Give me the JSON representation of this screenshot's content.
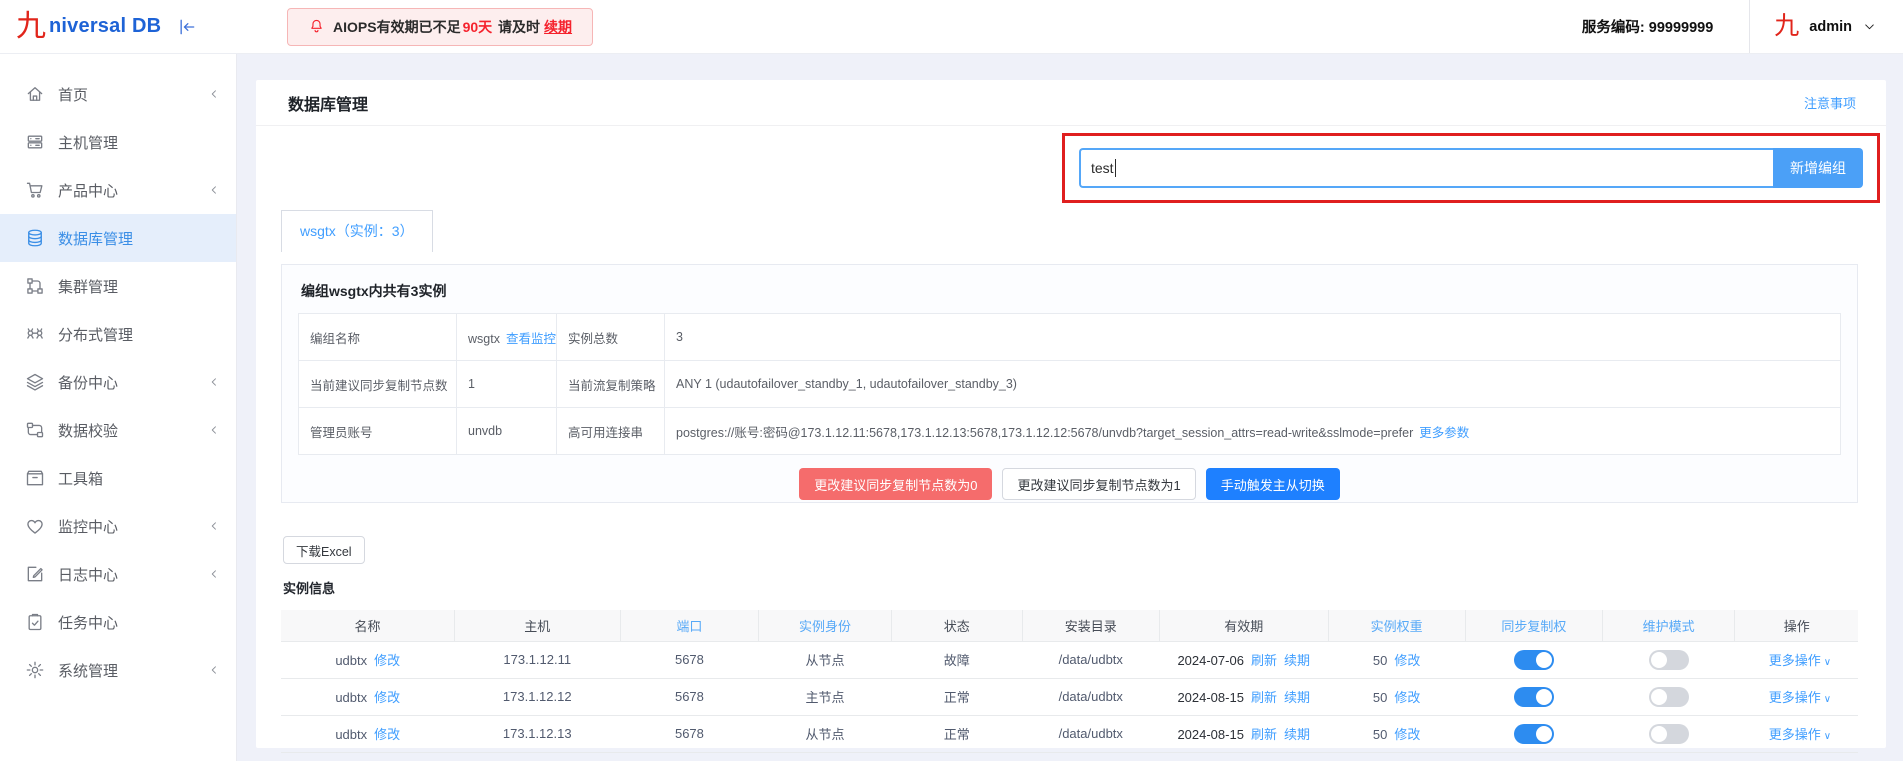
{
  "header": {
    "logo_glyph": "九",
    "logo_text": "niversal DB",
    "alert": {
      "prefix": "AIOPS有效期已不足",
      "days": "90天",
      "middle": "请及时",
      "renew_link": "续期"
    },
    "service_code_label": "服务编码:",
    "service_code_value": "99999999",
    "user_glyph": "九",
    "user_name": "admin"
  },
  "sidebar": {
    "items": [
      {
        "key": "home",
        "icon": "home-icon",
        "label": "首页",
        "active": false,
        "arrow": true
      },
      {
        "key": "host-management",
        "icon": "server-icon",
        "label": "主机管理",
        "active": false,
        "arrow": false
      },
      {
        "key": "product-center",
        "icon": "cart-icon",
        "label": "产品中心",
        "active": false,
        "arrow": true
      },
      {
        "key": "database-management",
        "icon": "database-icon",
        "label": "数据库管理",
        "active": true,
        "arrow": false
      },
      {
        "key": "cluster-management",
        "icon": "cluster-icon",
        "label": "集群管理",
        "active": false,
        "arrow": false
      },
      {
        "key": "distributed-management",
        "icon": "distributed-icon",
        "label": "分布式管理",
        "active": false,
        "arrow": false
      },
      {
        "key": "backup-center",
        "icon": "layers-icon",
        "label": "备份中心",
        "active": false,
        "arrow": true
      },
      {
        "key": "data-verification",
        "icon": "workflow-icon",
        "label": "数据校验",
        "active": false,
        "arrow": true
      },
      {
        "key": "toolbox",
        "icon": "toolbox-icon",
        "label": "工具箱",
        "active": false,
        "arrow": false
      },
      {
        "key": "monitor-center",
        "icon": "heart-icon",
        "label": "监控中心",
        "active": false,
        "arrow": true
      },
      {
        "key": "log-center",
        "icon": "edit-icon",
        "label": "日志中心",
        "active": false,
        "arrow": true
      },
      {
        "key": "task-center",
        "icon": "clipboard-icon",
        "label": "任务中心",
        "active": false,
        "arrow": false
      },
      {
        "key": "system-management",
        "icon": "gear-icon",
        "label": "系统管理",
        "active": false,
        "arrow": true
      }
    ]
  },
  "main": {
    "title": "数据库管理",
    "notice_link": "注意事项",
    "group_create": {
      "input_value": "test",
      "button_label": "新增编组"
    },
    "tab_label": "wsgtx（实例：3）",
    "group_panel": {
      "title": "编组wsgtx内共有3实例",
      "info_rows": [
        {
          "label1": "编组名称",
          "value1": "wsgtx",
          "value1_link": "查看监控",
          "label2": "实例总数",
          "value2": "3",
          "value2_link": ""
        },
        {
          "label1": "当前建议同步复制节点数",
          "value1": "1",
          "value1_link": "",
          "label2": "当前流复制策略",
          "value2": "ANY 1 (udautofailover_standby_1, udautofailover_standby_3)",
          "value2_link": ""
        },
        {
          "label1": "管理员账号",
          "value1": "unvdb",
          "value1_link": "",
          "label2": "高可用连接串",
          "value2": "postgres://账号:密码@173.1.12.11:5678,173.1.12.13:5678,173.1.12.12:5678/unvdb?target_session_attrs=read-write&sslmode=prefer",
          "value2_link": "更多参数"
        }
      ],
      "buttons": [
        {
          "label": "更改建议同步复制节点数为0",
          "variant": "danger"
        },
        {
          "label": "更改建议同步复制节点数为1",
          "variant": "plain"
        },
        {
          "label": "手动触发主从切换",
          "variant": "primary"
        }
      ]
    },
    "download_button": "下载Excel",
    "instance_section_title": "实例信息",
    "instance_table": {
      "columns": [
        {
          "label": "名称",
          "accent": false
        },
        {
          "label": "主机",
          "accent": false
        },
        {
          "label": "端口",
          "accent": true
        },
        {
          "label": "实例身份",
          "accent": true
        },
        {
          "label": "状态",
          "accent": false
        },
        {
          "label": "安装目录",
          "accent": false
        },
        {
          "label": "有效期",
          "accent": false
        },
        {
          "label": "实例权重",
          "accent": true
        },
        {
          "label": "同步复制权",
          "accent": true
        },
        {
          "label": "维护模式",
          "accent": true
        },
        {
          "label": "操作",
          "accent": false
        }
      ],
      "rows": [
        {
          "name": "udbtx",
          "name_link": "修改",
          "host": "173.1.12.11",
          "port": "5678",
          "role": "从节点",
          "status": "故障",
          "dir": "/data/udbtx",
          "expire": "2024-07-06",
          "refresh_link": "刷新",
          "renew_link": "续期",
          "weight": "50",
          "weight_link": "修改",
          "sync_on": true,
          "maintenance_on": false,
          "action_label": "更多操作"
        },
        {
          "name": "udbtx",
          "name_link": "修改",
          "host": "173.1.12.12",
          "port": "5678",
          "role": "主节点",
          "status": "正常",
          "dir": "/data/udbtx",
          "expire": "2024-08-15",
          "refresh_link": "刷新",
          "renew_link": "续期",
          "weight": "50",
          "weight_link": "修改",
          "sync_on": true,
          "maintenance_on": false,
          "action_label": "更多操作"
        },
        {
          "name": "udbtx",
          "name_link": "修改",
          "host": "173.1.12.13",
          "port": "5678",
          "role": "从节点",
          "status": "正常",
          "dir": "/data/udbtx",
          "expire": "2024-08-15",
          "refresh_link": "刷新",
          "renew_link": "续期",
          "weight": "50",
          "weight_link": "修改",
          "sync_on": true,
          "maintenance_on": false,
          "action_label": "更多操作"
        }
      ]
    }
  },
  "colors": {
    "accent_blue": "#409eff",
    "table_header_blue": "#57a9f7",
    "primary_button_blue": "#1e80ff",
    "add_button_blue": "#4ba0f7",
    "danger_red": "#f56c6c",
    "alert_red": "#f5222d",
    "annotation_red": "#e01f1f",
    "toggle_on": "#2d8cf0",
    "toggle_off": "#d4d7dd",
    "logo_red": "#e1251b",
    "logo_blue": "#1e63d6",
    "sidebar_active_bg": "#e5eefb",
    "page_bg": "#eff1f9"
  }
}
